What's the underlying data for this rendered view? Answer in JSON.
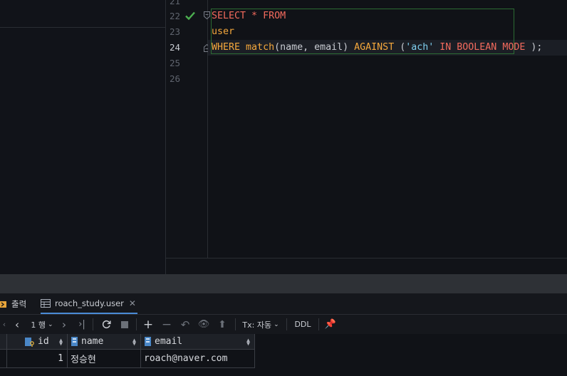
{
  "editor": {
    "line_numbers": [
      "21",
      "22",
      "23",
      "24",
      "25",
      "26"
    ],
    "current_line": "24",
    "lines": {
      "l22": {
        "kw1": "SELECT",
        "star": " * ",
        "kw2": "FROM"
      },
      "l23": {
        "table": "user"
      },
      "l24": {
        "kw_where": "WHERE",
        "fn_match": "match",
        "args": "(name, email) ",
        "kw_against": "AGAINST",
        "open": " (",
        "str": "'ach'",
        "kw_mode": " IN BOOLEAN MODE",
        "close": " );"
      }
    }
  },
  "bottom_tabs": [
    {
      "label": "출력"
    },
    {
      "label": "roach_study.user"
    }
  ],
  "toolbar": {
    "page_label": "1 행",
    "tx_label": "Tx: 자동",
    "ddl_label": "DDL"
  },
  "result_grid": {
    "columns": [
      "id",
      "name",
      "email"
    ],
    "rows": [
      {
        "id": "1",
        "name": "정승현",
        "email": "roach@naver.com"
      }
    ]
  },
  "colors": {
    "keyword": "#f36a5d",
    "function": "#f5a83c",
    "string": "#7fd0f0",
    "success": "#4caf50",
    "active_tab_underline": "#4a8bd6"
  }
}
